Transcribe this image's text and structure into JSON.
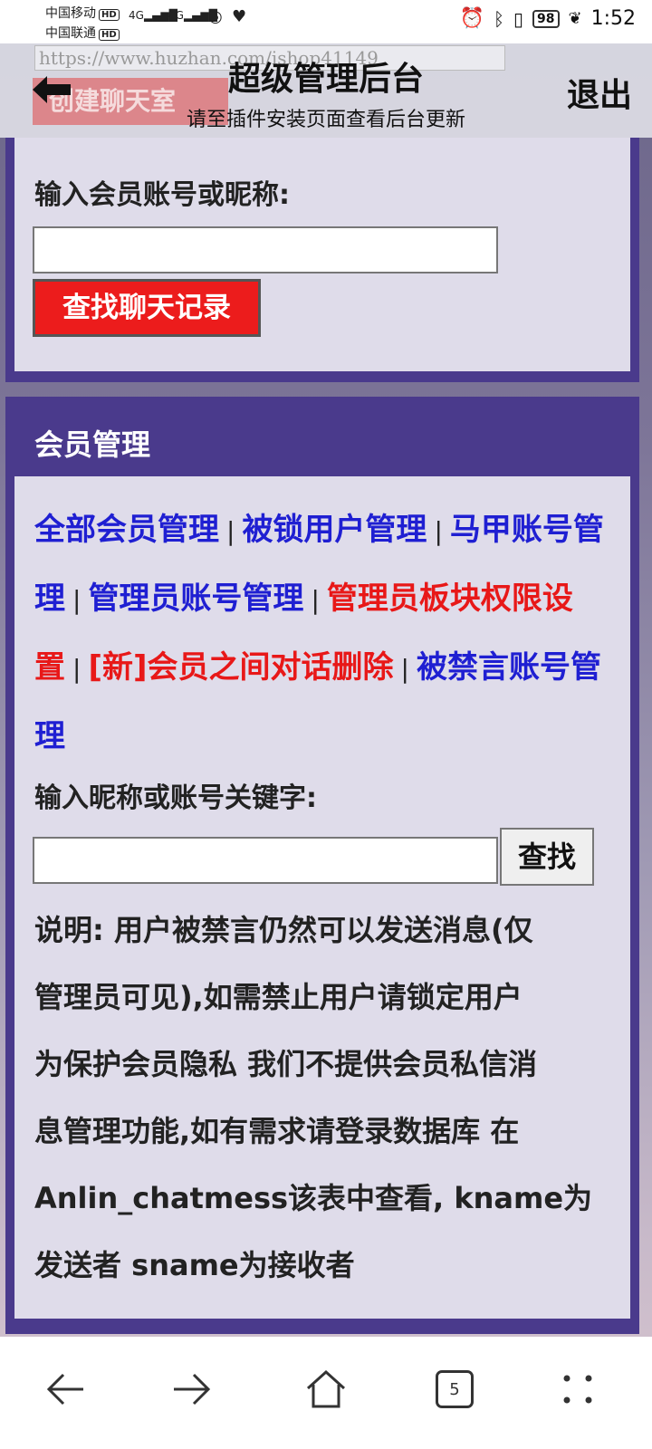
{
  "status_bar": {
    "carrier1": "中国移动",
    "carrier2": "中国联通",
    "hd": "HD",
    "net1": "4G",
    "net2": "4G",
    "battery": "98",
    "time": "1:52"
  },
  "header": {
    "ghost_url": "https://www.huzhan.com/ishop41149",
    "ghost_button": "创建聊天室",
    "title": "超级管理后台",
    "subtitle": "请至插件安装页面查看后台更新",
    "logout": "退出"
  },
  "chat_search": {
    "label": "输入会员账号或昵称:",
    "input_value": "",
    "button": "查找聊天记录"
  },
  "member_mgmt": {
    "title": "会员管理",
    "links": [
      {
        "label": "全部会员管理",
        "color": "#1f1fd2"
      },
      {
        "label": "被锁用户管理",
        "color": "#1f1fd2"
      },
      {
        "label": "马甲账号管理",
        "color": "#1f1fd2"
      },
      {
        "label": "管理员账号管理",
        "color": "#1f1fd2"
      },
      {
        "label": "管理员板块权限设置",
        "color": "#e81818"
      },
      {
        "label": "[新]会员之间对话删除",
        "color": "#e81818"
      },
      {
        "label": "被禁言账号管理",
        "color": "#1f1fd2"
      }
    ],
    "separator": "|",
    "search_label": "输入昵称或账号关键字:",
    "search_value": "",
    "search_button": "查找",
    "note_lines": [
      "说明: 用户被禁言仍然可以发送消息(仅",
      "管理员可见),如需禁止用户请锁定用户",
      "为保护会员隐私 我们不提供会员私信消",
      "息管理功能,如有需求请登录数据库 在",
      "Anlin_chatmess该表中查看, kname为",
      "发送者 sname为接收者"
    ]
  },
  "nav": {
    "tab_count": "5",
    "icons": [
      "back-icon",
      "forward-icon",
      "home-icon",
      "tabs-icon",
      "menu-icon"
    ]
  }
}
